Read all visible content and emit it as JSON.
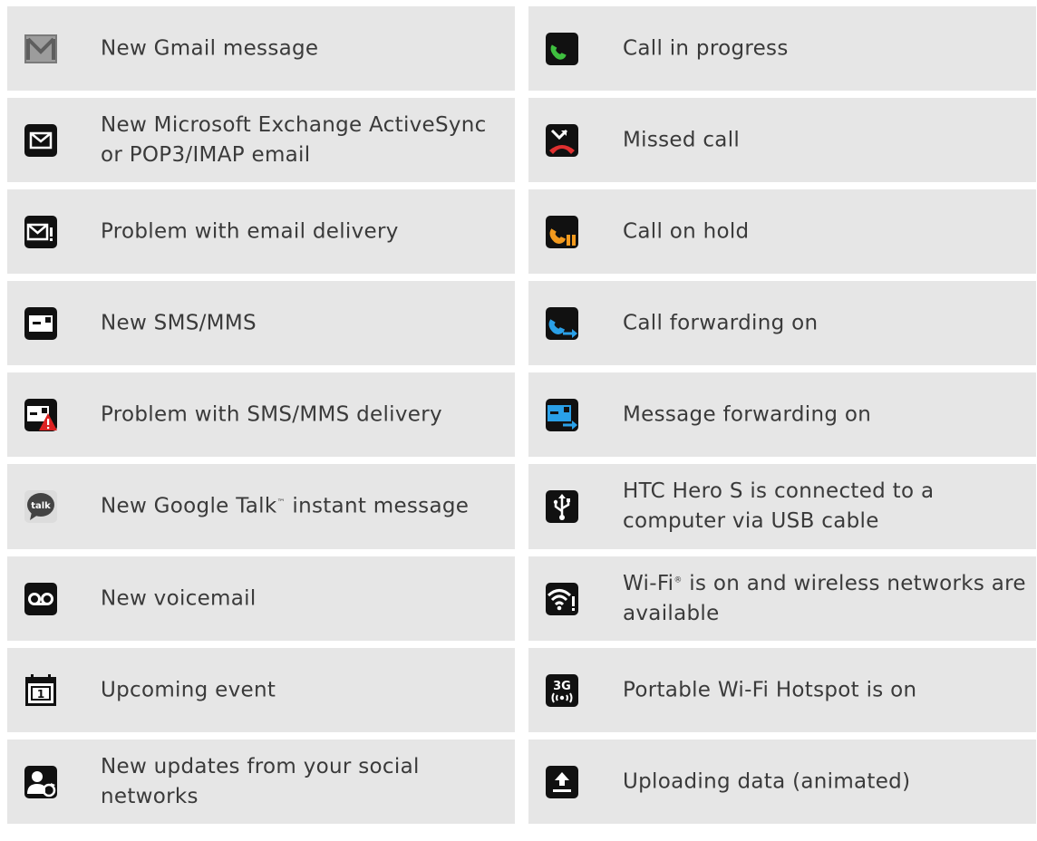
{
  "left": [
    {
      "icon": "gmail-icon",
      "label": "New Gmail message"
    },
    {
      "icon": "email-icon",
      "label": "New Microsoft Exchange ActiveSync or POP3/IMAP email"
    },
    {
      "icon": "email-problem-icon",
      "label": "Problem with email delivery"
    },
    {
      "icon": "sms-icon",
      "label": "New SMS/MMS"
    },
    {
      "icon": "sms-problem-icon",
      "label": "Problem with SMS/MMS delivery"
    },
    {
      "icon": "google-talk-icon",
      "label": "New Google Talk",
      "label_sup": "™",
      "label_after": " instant message"
    },
    {
      "icon": "voicemail-icon",
      "label": "New voicemail"
    },
    {
      "icon": "calendar-icon",
      "label": "Upcoming event"
    },
    {
      "icon": "social-update-icon",
      "label": "New updates from your social networks"
    }
  ],
  "right": [
    {
      "icon": "call-in-progress-icon",
      "label": "Call in progress"
    },
    {
      "icon": "missed-call-icon",
      "label": "Missed call"
    },
    {
      "icon": "call-on-hold-icon",
      "label": "Call on hold"
    },
    {
      "icon": "call-forwarding-icon",
      "label": "Call forwarding on"
    },
    {
      "icon": "message-forwarding-icon",
      "label": "Message forwarding on"
    },
    {
      "icon": "usb-icon",
      "label": "HTC Hero S is connected to a computer via USB cable"
    },
    {
      "icon": "wifi-icon",
      "label": "Wi-Fi",
      "label_sup": "®",
      "label_after": " is on and wireless networks are available"
    },
    {
      "icon": "hotspot-3g-icon",
      "label": "Portable Wi-Fi Hotspot is on",
      "badge": "3G"
    },
    {
      "icon": "upload-icon",
      "label": "Uploading data (animated)"
    }
  ]
}
